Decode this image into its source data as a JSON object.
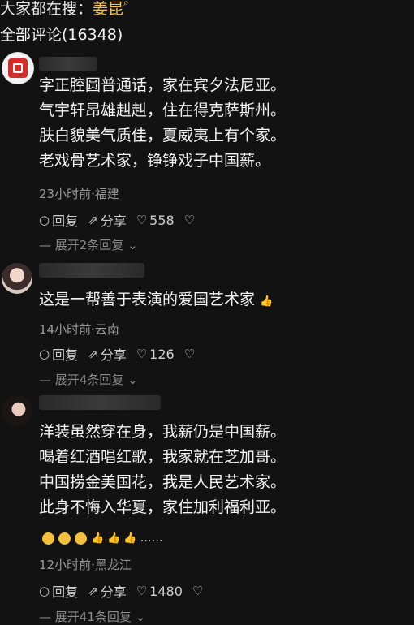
{
  "header": {
    "search_prefix": "大家都在搜：",
    "search_keyword": "姜昆",
    "search_icon": "search-icon",
    "comments_title": "全部评论(16348)"
  },
  "comments": [
    {
      "lines": [
        "字正腔圆普通话，家在宾夕法尼亚。",
        "气宇轩昂雄赳赳，住在得克萨斯州。",
        "肤白貌美气质佳，夏威夷上有个家。",
        "老戏骨艺术家，铮铮戏子中国薪。"
      ],
      "meta": "23小时前·福建",
      "reply": "回复",
      "share": "分享",
      "likes": "558",
      "expand": "展开2条回复"
    },
    {
      "lines": [
        "这是一帮善于表演的爱国艺术家"
      ],
      "meta": "14小时前·云南",
      "reply": "回复",
      "share": "分享",
      "likes": "126",
      "expand": "展开4条回复"
    },
    {
      "lines": [
        "洋装虽然穿在身，我薪仍是中国薪。",
        "喝着红酒唱红歌，我家就在芝加哥。",
        "中国捞金美国花，我是人民艺术家。",
        "此身不悔入华夏，家住加利福利亚。"
      ],
      "emoji_tail": "……",
      "meta": "12小时前·黑龙江",
      "reply": "回复",
      "share": "分享",
      "likes": "1480",
      "expand": "展开41条回复"
    }
  ]
}
